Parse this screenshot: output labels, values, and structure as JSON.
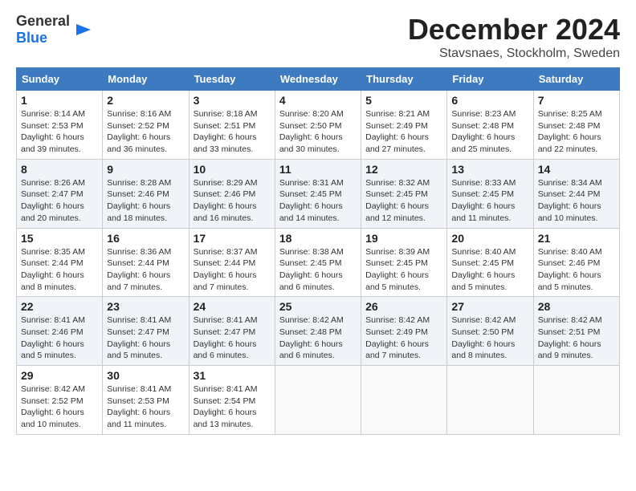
{
  "header": {
    "logo": {
      "line1": "General",
      "line2": "Blue"
    },
    "title": "December 2024",
    "location": "Stavsnaes, Stockholm, Sweden"
  },
  "weekdays": [
    "Sunday",
    "Monday",
    "Tuesday",
    "Wednesday",
    "Thursday",
    "Friday",
    "Saturday"
  ],
  "weeks": [
    [
      {
        "day": "1",
        "sunrise": "8:14 AM",
        "sunset": "2:53 PM",
        "daylight": "6 hours and 39 minutes."
      },
      {
        "day": "2",
        "sunrise": "8:16 AM",
        "sunset": "2:52 PM",
        "daylight": "6 hours and 36 minutes."
      },
      {
        "day": "3",
        "sunrise": "8:18 AM",
        "sunset": "2:51 PM",
        "daylight": "6 hours and 33 minutes."
      },
      {
        "day": "4",
        "sunrise": "8:20 AM",
        "sunset": "2:50 PM",
        "daylight": "6 hours and 30 minutes."
      },
      {
        "day": "5",
        "sunrise": "8:21 AM",
        "sunset": "2:49 PM",
        "daylight": "6 hours and 27 minutes."
      },
      {
        "day": "6",
        "sunrise": "8:23 AM",
        "sunset": "2:48 PM",
        "daylight": "6 hours and 25 minutes."
      },
      {
        "day": "7",
        "sunrise": "8:25 AM",
        "sunset": "2:48 PM",
        "daylight": "6 hours and 22 minutes."
      }
    ],
    [
      {
        "day": "8",
        "sunrise": "8:26 AM",
        "sunset": "2:47 PM",
        "daylight": "6 hours and 20 minutes."
      },
      {
        "day": "9",
        "sunrise": "8:28 AM",
        "sunset": "2:46 PM",
        "daylight": "6 hours and 18 minutes."
      },
      {
        "day": "10",
        "sunrise": "8:29 AM",
        "sunset": "2:46 PM",
        "daylight": "6 hours and 16 minutes."
      },
      {
        "day": "11",
        "sunrise": "8:31 AM",
        "sunset": "2:45 PM",
        "daylight": "6 hours and 14 minutes."
      },
      {
        "day": "12",
        "sunrise": "8:32 AM",
        "sunset": "2:45 PM",
        "daylight": "6 hours and 12 minutes."
      },
      {
        "day": "13",
        "sunrise": "8:33 AM",
        "sunset": "2:45 PM",
        "daylight": "6 hours and 11 minutes."
      },
      {
        "day": "14",
        "sunrise": "8:34 AM",
        "sunset": "2:44 PM",
        "daylight": "6 hours and 10 minutes."
      }
    ],
    [
      {
        "day": "15",
        "sunrise": "8:35 AM",
        "sunset": "2:44 PM",
        "daylight": "6 hours and 8 minutes."
      },
      {
        "day": "16",
        "sunrise": "8:36 AM",
        "sunset": "2:44 PM",
        "daylight": "6 hours and 7 minutes."
      },
      {
        "day": "17",
        "sunrise": "8:37 AM",
        "sunset": "2:44 PM",
        "daylight": "6 hours and 7 minutes."
      },
      {
        "day": "18",
        "sunrise": "8:38 AM",
        "sunset": "2:45 PM",
        "daylight": "6 hours and 6 minutes."
      },
      {
        "day": "19",
        "sunrise": "8:39 AM",
        "sunset": "2:45 PM",
        "daylight": "6 hours and 5 minutes."
      },
      {
        "day": "20",
        "sunrise": "8:40 AM",
        "sunset": "2:45 PM",
        "daylight": "6 hours and 5 minutes."
      },
      {
        "day": "21",
        "sunrise": "8:40 AM",
        "sunset": "2:46 PM",
        "daylight": "6 hours and 5 minutes."
      }
    ],
    [
      {
        "day": "22",
        "sunrise": "8:41 AM",
        "sunset": "2:46 PM",
        "daylight": "6 hours and 5 minutes."
      },
      {
        "day": "23",
        "sunrise": "8:41 AM",
        "sunset": "2:47 PM",
        "daylight": "6 hours and 5 minutes."
      },
      {
        "day": "24",
        "sunrise": "8:41 AM",
        "sunset": "2:47 PM",
        "daylight": "6 hours and 6 minutes."
      },
      {
        "day": "25",
        "sunrise": "8:42 AM",
        "sunset": "2:48 PM",
        "daylight": "6 hours and 6 minutes."
      },
      {
        "day": "26",
        "sunrise": "8:42 AM",
        "sunset": "2:49 PM",
        "daylight": "6 hours and 7 minutes."
      },
      {
        "day": "27",
        "sunrise": "8:42 AM",
        "sunset": "2:50 PM",
        "daylight": "6 hours and 8 minutes."
      },
      {
        "day": "28",
        "sunrise": "8:42 AM",
        "sunset": "2:51 PM",
        "daylight": "6 hours and 9 minutes."
      }
    ],
    [
      {
        "day": "29",
        "sunrise": "8:42 AM",
        "sunset": "2:52 PM",
        "daylight": "6 hours and 10 minutes."
      },
      {
        "day": "30",
        "sunrise": "8:41 AM",
        "sunset": "2:53 PM",
        "daylight": "6 hours and 11 minutes."
      },
      {
        "day": "31",
        "sunrise": "8:41 AM",
        "sunset": "2:54 PM",
        "daylight": "6 hours and 13 minutes."
      },
      null,
      null,
      null,
      null
    ]
  ]
}
